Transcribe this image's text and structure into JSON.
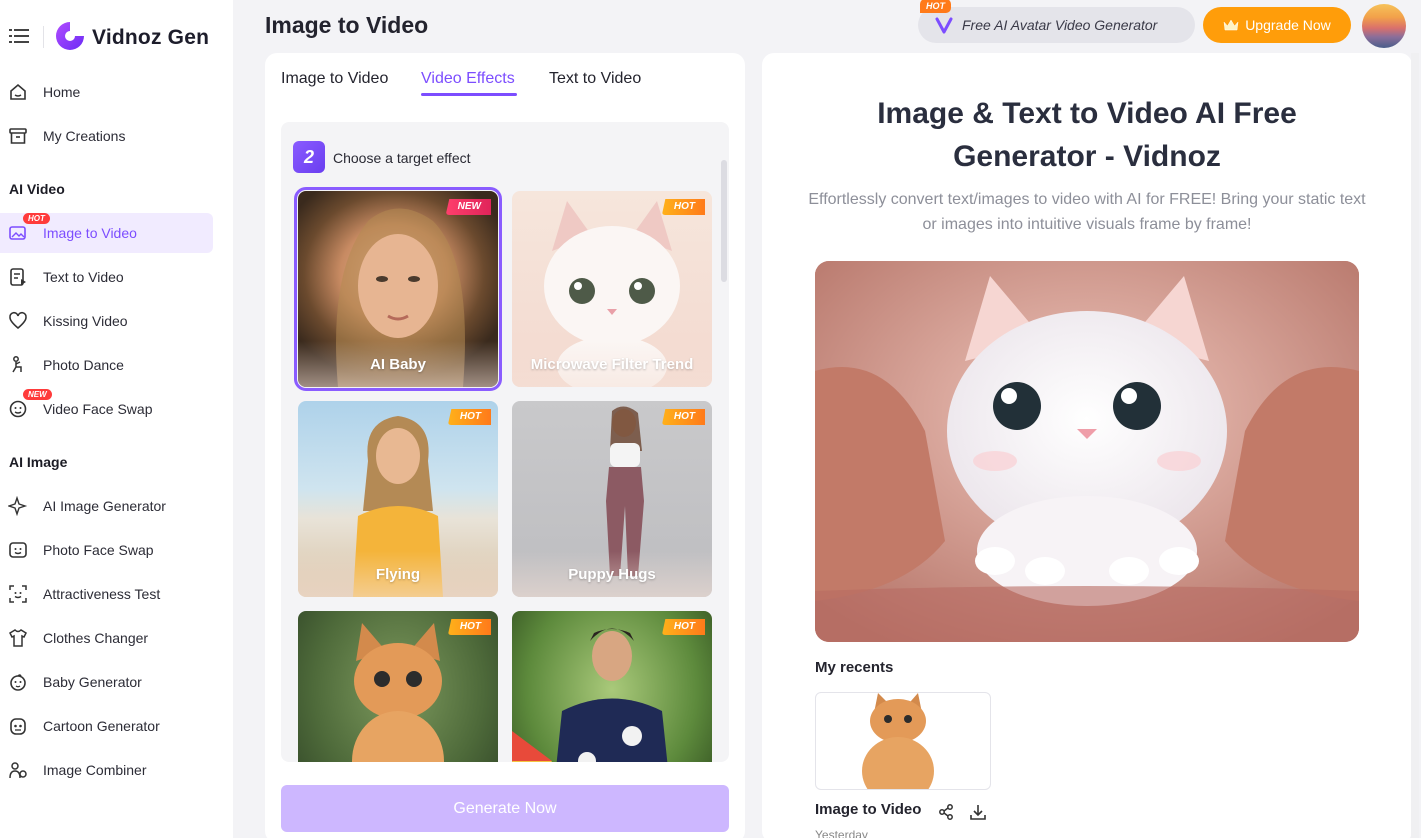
{
  "brand": {
    "name": "Vidnoz Gen"
  },
  "header": {
    "title": "Image to Video",
    "promo": {
      "text": "Free AI Avatar Video Generator",
      "badge": "HOT"
    },
    "upgrade_label": "Upgrade Now"
  },
  "sidebar": {
    "items_top": [
      {
        "label": "Home",
        "icon": "home-icon"
      },
      {
        "label": "My Creations",
        "icon": "box-icon"
      }
    ],
    "section_video": "AI Video",
    "video_items": [
      {
        "label": "Image to Video",
        "icon": "image-video-icon",
        "badge": "HOT",
        "active": true
      },
      {
        "label": "Text to Video",
        "icon": "text-video-icon"
      },
      {
        "label": "Kissing Video",
        "icon": "heart-icon"
      },
      {
        "label": "Photo Dance",
        "icon": "dance-icon"
      },
      {
        "label": "Video Face Swap",
        "icon": "face-swap-icon",
        "badge": "NEW"
      }
    ],
    "section_image": "AI Image",
    "image_items": [
      {
        "label": "AI Image Generator",
        "icon": "sparkle-icon"
      },
      {
        "label": "Photo Face Swap",
        "icon": "photo-face-icon"
      },
      {
        "label": "Attractiveness Test",
        "icon": "face-scan-icon"
      },
      {
        "label": "Clothes Changer",
        "icon": "shirt-icon"
      },
      {
        "label": "Baby Generator",
        "icon": "baby-icon"
      },
      {
        "label": "Cartoon Generator",
        "icon": "cartoon-icon"
      },
      {
        "label": "Image Combiner",
        "icon": "combiner-icon"
      }
    ]
  },
  "tabs": [
    {
      "label": "Image to Video"
    },
    {
      "label": "Video Effects",
      "active": true
    },
    {
      "label": "Text to Video"
    }
  ],
  "effects": {
    "step_number": "2",
    "step_text": "Choose a target effect",
    "cards": [
      {
        "label": "AI Baby",
        "tag": "NEW",
        "selected": true
      },
      {
        "label": "Microwave Filter Trend",
        "tag": "HOT"
      },
      {
        "label": "Flying",
        "tag": "HOT"
      },
      {
        "label": "Puppy Hugs",
        "tag": "HOT"
      },
      {
        "label": "",
        "tag": "HOT"
      },
      {
        "label": "",
        "tag": "HOT"
      }
    ]
  },
  "generate_label": "Generate Now",
  "hero": {
    "title": "Image & Text to Video AI Free Generator - Vidnoz",
    "subtitle": "Effortlessly convert text/images to video with AI for FREE! Bring your static text or images into intuitive visuals frame by frame!"
  },
  "recents": {
    "title": "My recents",
    "item_label": "Image to Video",
    "item_date": "Yesterday"
  },
  "colors": {
    "accent": "#7c4dff",
    "upgrade": "#ff9d0a",
    "hot": "#ff7a1a",
    "new": "#ff3f6c"
  }
}
